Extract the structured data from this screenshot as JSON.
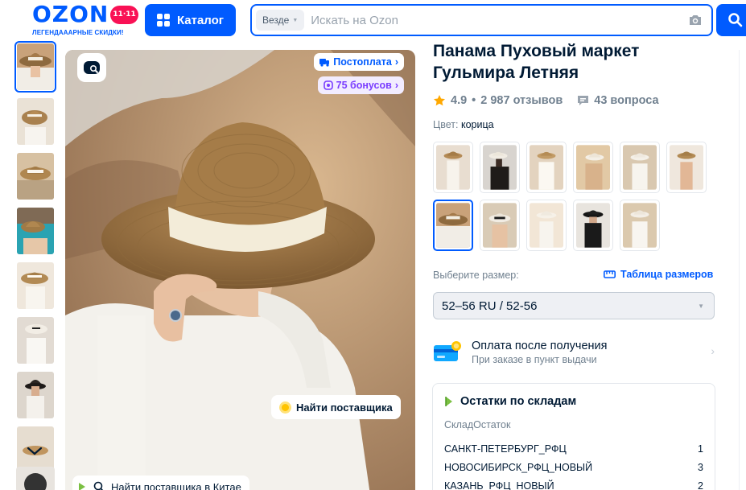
{
  "header": {
    "logo_text": "OZON",
    "logo_badge": "11·11",
    "logo_subtitle": "ЛЕГЕНДАААРНЫЕ СКИДКИ!",
    "catalog_label": "Каталог",
    "search": {
      "scope": "Везде",
      "placeholder": "Искать на Ozon",
      "value": ""
    }
  },
  "gallery": {
    "badges": {
      "postpay": "Постоплата",
      "bonus": "75 бонусов"
    },
    "find_supplier": "Найти поставщика",
    "find_supplier_china": "Найти поставщика в Китае"
  },
  "product": {
    "title": "Панама Пуховый маркет Гульмира Летняя",
    "rating": "4.9",
    "reviews": "2 987 отзывов",
    "questions": "43 вопроса",
    "color_label": "Цвет:",
    "color_value": "корица",
    "size_label": "Выберите размер:",
    "size_table_link": "Таблица размеров",
    "size_selected": "52–56 RU / 52-56"
  },
  "payment": {
    "title": "Оплата после получения",
    "subtitle": "При заказе в пункт выдачи"
  },
  "stock": {
    "title": "Остатки по складам",
    "header": "СкладОстаток",
    "rows": [
      {
        "warehouse": "САНКТ-ПЕТЕРБУРГ_РФЦ",
        "qty": "1"
      },
      {
        "warehouse": "НОВОСИБИРСК_РФЦ_НОВЫЙ",
        "qty": "3"
      },
      {
        "warehouse": "КАЗАНЬ_РФЦ_НОВЫЙ",
        "qty": "2"
      }
    ]
  },
  "colors": {
    "brand_blue": "#005bff",
    "brand_pink": "#f91155",
    "bonus_purple": "#7a3dff",
    "star": "#ffa800"
  }
}
